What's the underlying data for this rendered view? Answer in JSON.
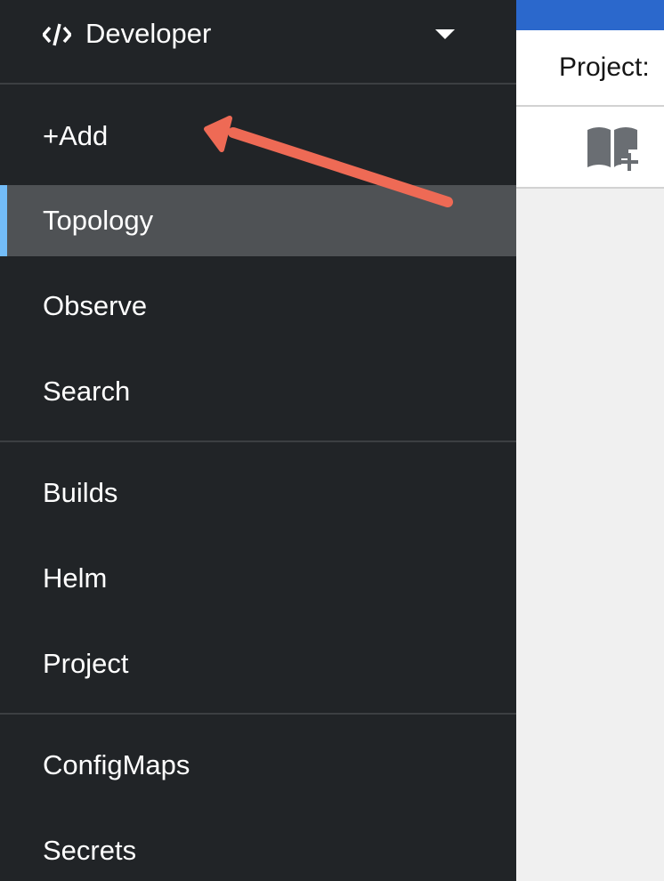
{
  "header": {
    "project_label": "Project:",
    "accent_color": "#2b68cc"
  },
  "toolbar": {
    "getting_started_icon": "book-plus-icon"
  },
  "sidebar": {
    "perspective": {
      "icon": "code-icon",
      "label": "Developer",
      "caret_icon": "caret-down-icon"
    },
    "items": [
      {
        "label": "+Add",
        "active": false
      },
      {
        "label": "Topology",
        "active": true
      },
      {
        "label": "Observe",
        "active": false
      },
      {
        "label": "Search",
        "active": false
      },
      {
        "label": "Builds",
        "active": false
      },
      {
        "label": "Helm",
        "active": false
      },
      {
        "label": "Project",
        "active": false
      },
      {
        "label": "ConfigMaps",
        "active": false
      },
      {
        "label": "Secrets",
        "active": false
      }
    ],
    "colors": {
      "background": "#212427",
      "active_background": "#4f5255",
      "active_indicator": "#73bcf7"
    }
  },
  "annotation": {
    "type": "arrow",
    "color": "#ee6a55",
    "points_to": "+Add"
  }
}
